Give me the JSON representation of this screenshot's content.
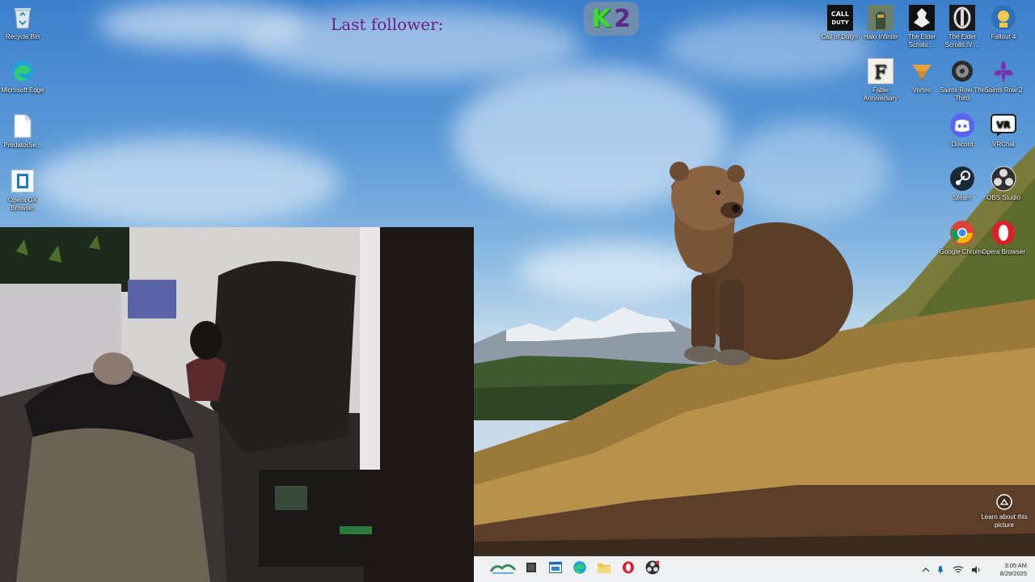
{
  "overlay": {
    "last_follower_label": "Last follower:",
    "badge_k": "K",
    "badge_2": "2"
  },
  "desktop_icons_left": [
    {
      "label": "Recycle Bin",
      "icon": "recycle-bin-icon"
    },
    {
      "label": "Microsoft Edge",
      "icon": "edge-icon"
    },
    {
      "label": "PredatorSe...",
      "icon": "file-icon"
    },
    {
      "label": "Opera GX Browser",
      "icon": "opera-gx-icon"
    }
  ],
  "desktop_icons_right": [
    {
      "label": "Call of Duty®",
      "icon": "call-of-duty-icon"
    },
    {
      "label": "Halo Infinite",
      "icon": "halo-icon"
    },
    {
      "label": "The Elder Scrolls ...",
      "icon": "elder-scrolls-icon"
    },
    {
      "label": "The Elder Scrolls IV ...",
      "icon": "oblivion-icon"
    },
    {
      "label": "Fallout 4",
      "icon": "fallout-icon"
    },
    {
      "label": "Fable Anniversary",
      "icon": "fable-icon"
    },
    {
      "label": "Vortex",
      "icon": "vortex-icon"
    },
    {
      "label": "Saints Row The Third",
      "icon": "saints-row-3-icon"
    },
    {
      "label": "Saints Row 2",
      "icon": "saints-row-2-icon"
    },
    {
      "label": "Discord",
      "icon": "discord-icon"
    },
    {
      "label": "VRChat",
      "icon": "vrchat-icon"
    },
    {
      "label": "Steam",
      "icon": "steam-icon"
    },
    {
      "label": "OBS Studio",
      "icon": "obs-icon"
    },
    {
      "label": "Google Chrome",
      "icon": "chrome-icon"
    },
    {
      "label": "Opera Browser",
      "icon": "opera-icon"
    }
  ],
  "learn_picture": {
    "label": "Learn about this picture",
    "icon": "camera-icon"
  },
  "taskbar": {
    "apps": [
      "widgets-icon",
      "task-view-icon",
      "terminal-icon",
      "edge-icon",
      "file-explorer-icon",
      "opera-icon",
      "obs-icon"
    ],
    "tray_icons": [
      "chevron-up-icon",
      "microphone-icon",
      "wifi-icon",
      "volume-icon"
    ],
    "time": "3:05 AM",
    "date": "8/29/2025"
  },
  "colors": {
    "overlay_text": "#6a1e86",
    "badge_k": "#3ddc2f",
    "badge_2": "#5b2a86",
    "taskbar_bg": "#eef0f2"
  }
}
